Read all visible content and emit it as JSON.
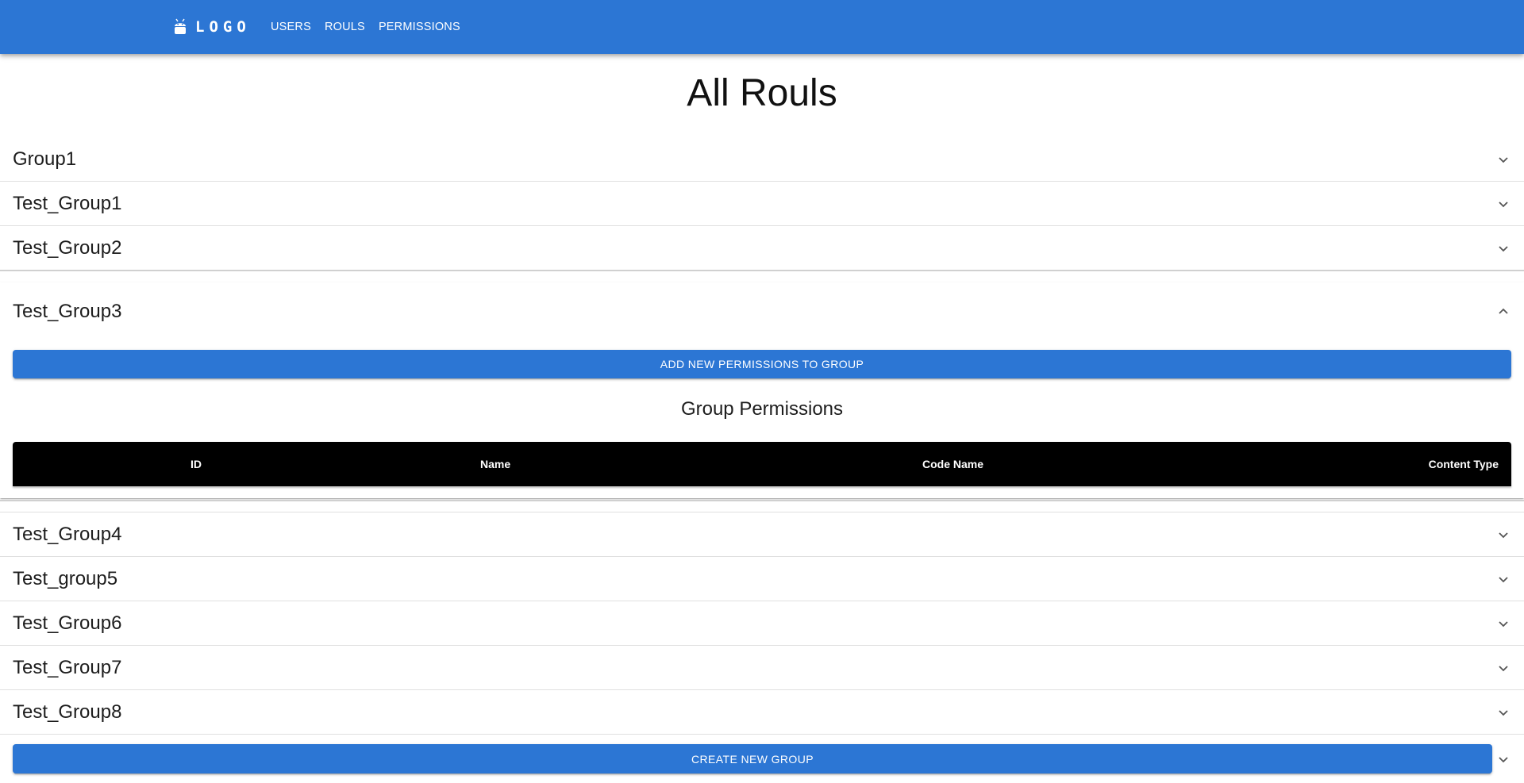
{
  "navbar": {
    "logo_text": "LOGO",
    "links": [
      "USERS",
      "ROULS",
      "PERMISSIONS"
    ]
  },
  "page_title": "All Rouls",
  "groups": [
    {
      "name": "Group1",
      "expanded": false
    },
    {
      "name": "Test_Group1",
      "expanded": false
    },
    {
      "name": "Test_Group2",
      "expanded": false
    },
    {
      "name": "Test_Group3",
      "expanded": true
    },
    {
      "name": "Test_Group4",
      "expanded": false
    },
    {
      "name": "Test_group5",
      "expanded": false
    },
    {
      "name": "Test_Group6",
      "expanded": false
    },
    {
      "name": "Test_Group7",
      "expanded": false
    },
    {
      "name": "Test_Group8",
      "expanded": false
    }
  ],
  "expanded_group": {
    "add_button_label": "ADD NEW PERMISSIONS TO GROUP",
    "section_title": "Group Permissions",
    "table_columns": [
      "ID",
      "Name",
      "Code Name",
      "Content Type"
    ]
  },
  "create_button_label": "CREATE NEW GROUP",
  "colors": {
    "primary": "#2c76d4",
    "table_header": "#000000"
  },
  "icons": {
    "logo": "android-icon",
    "collapsed": "chevron-down-icon",
    "expanded": "chevron-up-icon"
  }
}
